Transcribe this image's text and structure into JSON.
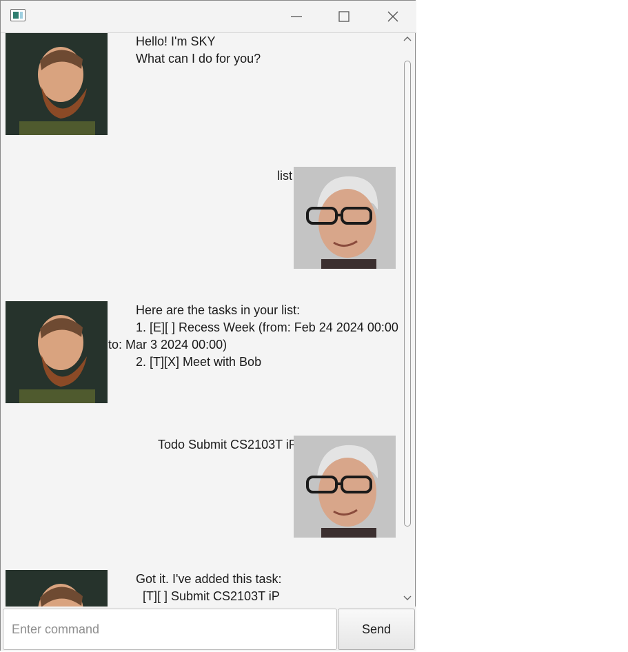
{
  "window": {
    "icon": "app-icon",
    "controls": [
      "minimize-icon",
      "maximize-icon",
      "close-icon"
    ]
  },
  "chat": {
    "messages": [
      {
        "sender": "duke",
        "lines": [
          "Hello! I'm SKY",
          "What can I do for you?"
        ]
      },
      {
        "sender": "user",
        "text": "list"
      },
      {
        "sender": "duke",
        "lines": [
          "Here are the tasks in your list:",
          "1. [E][ ] Recess Week (from: Feb 24 2024 00:00",
          "to: Mar 3 2024 00:00)",
          "2. [T][X] Meet with Bob"
        ]
      },
      {
        "sender": "user",
        "text": "Todo Submit CS2103T iP"
      },
      {
        "sender": "duke",
        "lines": [
          "Got it. I've added this task:",
          "  [T][ ] Submit CS2103T iP"
        ]
      }
    ]
  },
  "input": {
    "placeholder": "Enter command",
    "value": ""
  },
  "send_button": {
    "label": "Send"
  }
}
